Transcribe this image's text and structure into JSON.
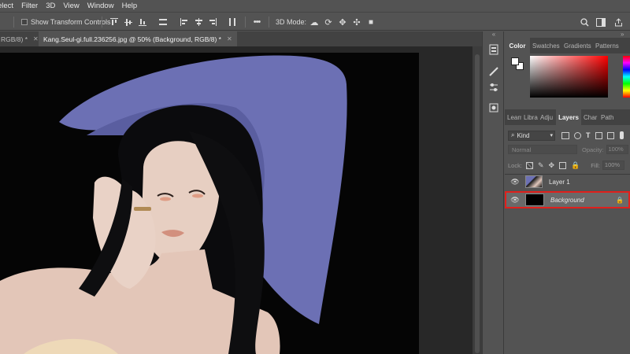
{
  "menu": [
    "elect",
    "Filter",
    "3D",
    "View",
    "Window",
    "Help"
  ],
  "options": {
    "show_transform_label": "Show Transform Controls",
    "mode_label": "3D Mode:",
    "more": "•••"
  },
  "tabs": [
    {
      "label": "RGB/8) *"
    },
    {
      "label": "Kang.Seul-gi.full.236256.jpg @ 50% (Background, RGB/8) *"
    }
  ],
  "color_panel": {
    "tabs": [
      "Color",
      "Swatches",
      "Gradients",
      "Patterns"
    ]
  },
  "layers_panel": {
    "tabs": [
      "Learn",
      "Libra",
      "Adju",
      "Layers",
      "Char",
      "Path"
    ],
    "kind_label": "Kind",
    "blend_mode": "Normal",
    "opacity_label": "Opacity:",
    "opacity_value": "100%",
    "lock_label": "Lock:",
    "fill_label": "Fill:",
    "fill_value": "100%",
    "layers": [
      {
        "name": "Layer 1"
      },
      {
        "name": "Background"
      }
    ]
  },
  "colors": {
    "selection_highlight": "#e0201c",
    "hat": "#6c70b4",
    "photo_bg": "#050505"
  }
}
